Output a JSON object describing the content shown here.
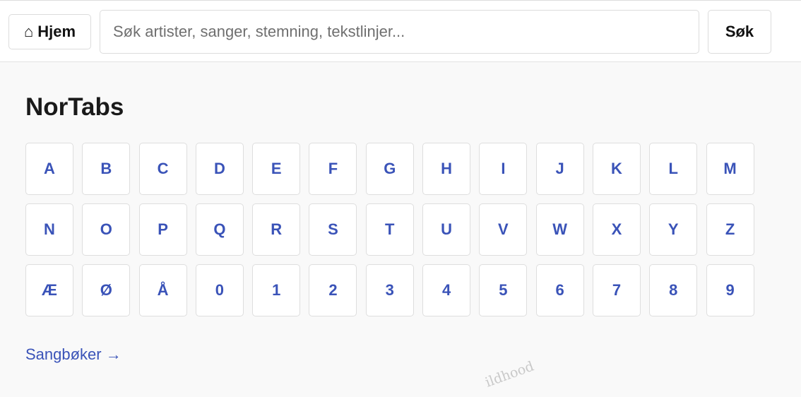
{
  "header": {
    "home_icon": "⌂",
    "home_label": "Hjem",
    "search_placeholder": "Søk artister, sanger, stemning, tekstlinjer...",
    "search_value": "",
    "search_button_label": "Søk"
  },
  "main": {
    "title": "NorTabs",
    "keys": [
      "A",
      "B",
      "C",
      "D",
      "E",
      "F",
      "G",
      "H",
      "I",
      "J",
      "K",
      "L",
      "M",
      "N",
      "O",
      "P",
      "Q",
      "R",
      "S",
      "T",
      "U",
      "V",
      "W",
      "X",
      "Y",
      "Z",
      "Æ",
      "Ø",
      "Å",
      "0",
      "1",
      "2",
      "3",
      "4",
      "5",
      "6",
      "7",
      "8",
      "9"
    ],
    "songbooks_link": "Sangbøker →",
    "watermark_text": "ildhood"
  },
  "colors": {
    "link": "#3a53b8",
    "background": "#f9f9f9",
    "surface": "#ffffff",
    "border": "#dcdcdc"
  }
}
